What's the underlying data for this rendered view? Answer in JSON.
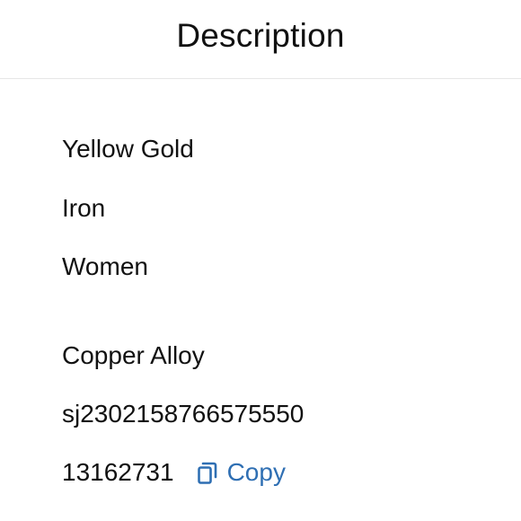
{
  "header": {
    "title": "Description"
  },
  "details": {
    "color": "Yellow Gold",
    "material_base": "Iron",
    "gender": "Women",
    "material_alloy": "Copper Alloy",
    "sku": "sj2302158766575550",
    "item_number": "13162731",
    "copy_label": "Copy"
  },
  "colors": {
    "link": "#2f6fb3",
    "text": "#111111",
    "divider": "#e6e6e6"
  },
  "icons": {
    "copy": "copy-icon"
  }
}
